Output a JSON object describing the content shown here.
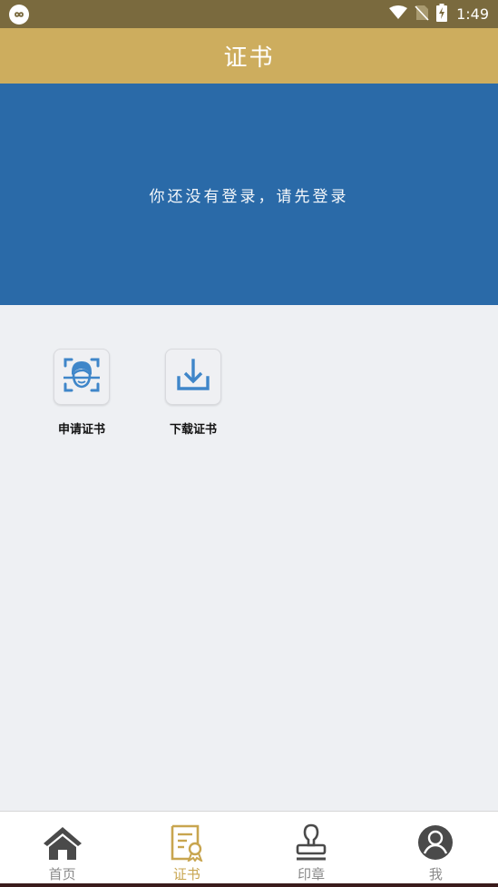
{
  "status_bar": {
    "time": "1:49",
    "icons": [
      "app-icon",
      "wifi-icon",
      "no-sim-icon",
      "battery-charging-icon"
    ]
  },
  "header": {
    "title": "证书"
  },
  "banner": {
    "message": "你还没有登录，请先登录"
  },
  "features": [
    {
      "label": "申请证书",
      "icon": "face-scan-icon"
    },
    {
      "label": "下载证书",
      "icon": "download-icon"
    }
  ],
  "tabs": [
    {
      "label": "首页",
      "icon": "home-icon",
      "active": false
    },
    {
      "label": "证书",
      "icon": "certificate-icon",
      "active": true
    },
    {
      "label": "印章",
      "icon": "stamp-icon",
      "active": false
    },
    {
      "label": "我",
      "icon": "user-icon",
      "active": false
    }
  ],
  "colors": {
    "status_bar": "#7a6a3e",
    "header": "#cdad5e",
    "banner": "#2a6aa8",
    "accent_blue": "#3f86c9",
    "active_tab": "#c8a54f",
    "inactive_tab": "#8a8a8a"
  }
}
